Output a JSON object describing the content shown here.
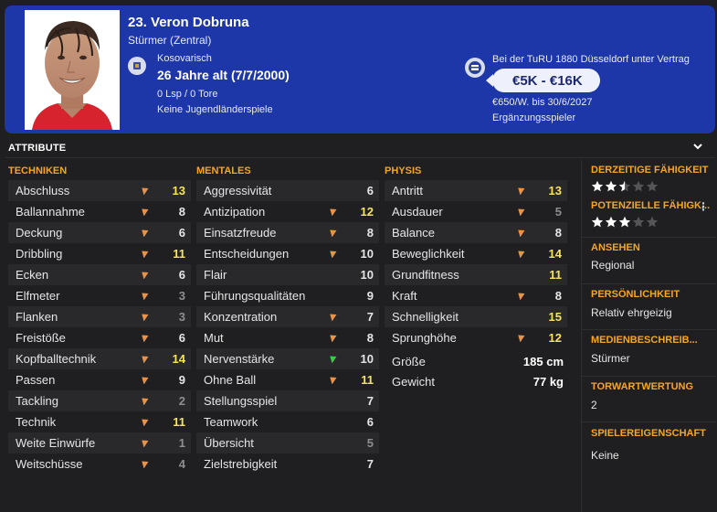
{
  "player": {
    "name": "23. Veron Dobruna",
    "position": "Stürmer (Zentral)",
    "nationality": "Kosovarisch",
    "age": "26 Jahre alt",
    "birthdate": "(7/7/2000)",
    "appearances": "0 Lsp / 0 Tore",
    "youth": "Keine Jugendländerspiele",
    "contract": "Bei der TuRU 1880 Düsseldorf unter Vertrag",
    "value": "€5K - €16K",
    "wage": "€650/W. bis 30/6/2027",
    "role": "Ergänzungsspieler"
  },
  "attributes": {
    "title": "ATTRIBUTE",
    "technical": {
      "title": "TECHNIKEN",
      "rows": [
        {
          "label": "Abschluss",
          "value": "13",
          "arrow": "up",
          "color": "yellow"
        },
        {
          "label": "Ballannahme",
          "value": "8",
          "arrow": "up",
          "color": "white"
        },
        {
          "label": "Deckung",
          "value": "6",
          "arrow": "up",
          "color": "white"
        },
        {
          "label": "Dribbling",
          "value": "11",
          "arrow": "up",
          "color": "yellow"
        },
        {
          "label": "Ecken",
          "value": "6",
          "arrow": "up",
          "color": "white"
        },
        {
          "label": "Elfmeter",
          "value": "3",
          "arrow": "up",
          "color": "dim"
        },
        {
          "label": "Flanken",
          "value": "3",
          "arrow": "up",
          "color": "dim"
        },
        {
          "label": "Freistöße",
          "value": "6",
          "arrow": "up",
          "color": "white"
        },
        {
          "label": "Kopfballtechnik",
          "value": "14",
          "arrow": "up",
          "color": "yellow"
        },
        {
          "label": "Passen",
          "value": "9",
          "arrow": "up",
          "color": "white"
        },
        {
          "label": "Tackling",
          "value": "2",
          "arrow": "up",
          "color": "dim"
        },
        {
          "label": "Technik",
          "value": "11",
          "arrow": "up",
          "color": "yellow"
        },
        {
          "label": "Weite Einwürfe",
          "value": "1",
          "arrow": "up",
          "color": "dim"
        },
        {
          "label": "Weitschüsse",
          "value": "4",
          "arrow": "up",
          "color": "dim"
        }
      ]
    },
    "mental": {
      "title": "MENTALES",
      "rows": [
        {
          "label": "Aggressivität",
          "value": "6",
          "arrow": "",
          "color": "white"
        },
        {
          "label": "Antizipation",
          "value": "12",
          "arrow": "up",
          "color": "yellow"
        },
        {
          "label": "Einsatzfreude",
          "value": "8",
          "arrow": "up",
          "color": "white"
        },
        {
          "label": "Entscheidungen",
          "value": "10",
          "arrow": "up",
          "color": "white"
        },
        {
          "label": "Flair",
          "value": "10",
          "arrow": "",
          "color": "white"
        },
        {
          "label": "Führungsqualitäten",
          "value": "9",
          "arrow": "",
          "color": "white"
        },
        {
          "label": "Konzentration",
          "value": "7",
          "arrow": "up",
          "color": "white"
        },
        {
          "label": "Mut",
          "value": "8",
          "arrow": "up",
          "color": "white"
        },
        {
          "label": "Nervenstärke",
          "value": "10",
          "arrow": "up-green",
          "color": "white"
        },
        {
          "label": "Ohne Ball",
          "value": "11",
          "arrow": "up",
          "color": "yellow"
        },
        {
          "label": "Stellungsspiel",
          "value": "7",
          "arrow": "",
          "color": "white"
        },
        {
          "label": "Teamwork",
          "value": "6",
          "arrow": "",
          "color": "white"
        },
        {
          "label": "Übersicht",
          "value": "5",
          "arrow": "",
          "color": "dim"
        },
        {
          "label": "Zielstrebigkeit",
          "value": "7",
          "arrow": "",
          "color": "white"
        }
      ]
    },
    "physical": {
      "title": "PHYSIS",
      "rows": [
        {
          "label": "Antritt",
          "value": "13",
          "arrow": "up",
          "color": "yellow"
        },
        {
          "label": "Ausdauer",
          "value": "5",
          "arrow": "up",
          "color": "dim"
        },
        {
          "label": "Balance",
          "value": "8",
          "arrow": "up",
          "color": "white"
        },
        {
          "label": "Beweglichkeit",
          "value": "14",
          "arrow": "up",
          "color": "yellow"
        },
        {
          "label": "Grundfitness",
          "value": "11",
          "arrow": "",
          "color": "yellow"
        },
        {
          "label": "Kraft",
          "value": "8",
          "arrow": "up",
          "color": "white"
        },
        {
          "label": "Schnelligkeit",
          "value": "15",
          "arrow": "",
          "color": "yellow"
        },
        {
          "label": "Sprunghöhe",
          "value": "12",
          "arrow": "up",
          "color": "yellow"
        }
      ],
      "height_label": "Größe",
      "height_value": "185 cm",
      "weight_label": "Gewicht",
      "weight_value": "77 kg"
    }
  },
  "sidebar": {
    "current_ability_title": "DERZEITIGE FÄHIGKEIT",
    "current_ability_stars": 2.5,
    "potential_ability_title": "POTENZIELLE FÄHIGK...",
    "potential_ability_stars": 3,
    "reputation_title": "ANSEHEN",
    "reputation_value": "Regional",
    "personality_title": "PERSÖNLICHKEIT",
    "personality_value": "Relativ ehrgeizig",
    "media_title": "MEDIENBESCHREIB...",
    "media_value": "Stürmer",
    "gk_title": "TORWARTWERTUNG",
    "gk_value": "2",
    "traits_title": "SPIELEREIGENSCHAFT",
    "traits_value": "Keine"
  },
  "colors": {
    "header_blue": "#1d36a8",
    "accent_orange": "#f5a623",
    "value_yellow": "#f4e45e",
    "arrow_orange": "#e8934a",
    "arrow_green": "#3cc84a"
  }
}
